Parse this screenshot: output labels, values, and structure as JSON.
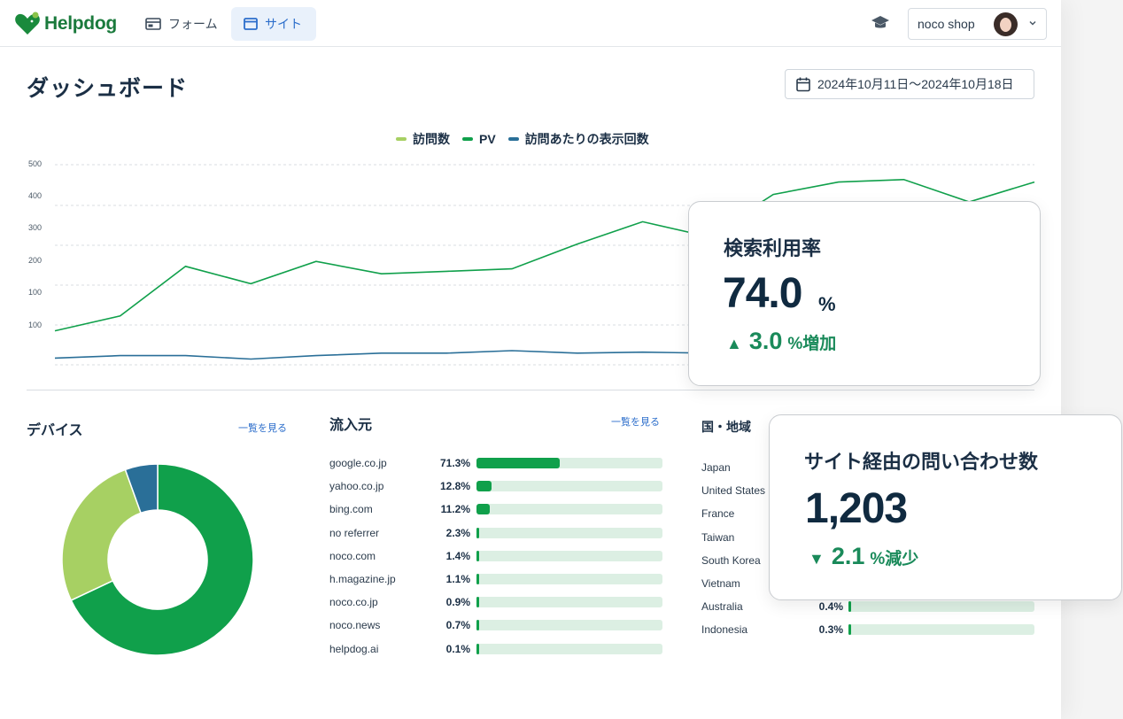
{
  "topbar": {
    "logo_text": "Helpdog",
    "nav": [
      {
        "label": "フォーム",
        "icon": "form-icon"
      },
      {
        "label": "サイト",
        "icon": "window-icon",
        "active": true
      }
    ],
    "shop_name": "noco shop"
  },
  "header": {
    "title": "ダッシュボード",
    "date_range": "2024年10月11日〜2024年10月18日"
  },
  "chart_data": {
    "type": "line",
    "legend": [
      {
        "name": "訪問数",
        "color": "#a7d063"
      },
      {
        "name": "PV",
        "color": "#10a04b"
      },
      {
        "name": "訪問あたりの表示回数",
        "color": "#2a6f98"
      }
    ],
    "y_tick_labels": [
      "500",
      "400",
      "300",
      "200",
      "100",
      "100"
    ],
    "series": [
      {
        "name": "PV",
        "color": "#10a04b",
        "values": [
          145,
          175,
          275,
          240,
          285,
          260,
          265,
          270,
          320,
          365,
          335,
          420,
          445,
          450,
          405,
          445
        ]
      },
      {
        "name": "訪問あたりの表示回数",
        "color": "#2a6f98",
        "values": [
          90,
          95,
          95,
          88,
          95,
          100,
          100,
          105,
          100,
          102,
          100,
          100,
          100,
          100,
          100,
          100
        ]
      }
    ],
    "ylim": [
      80,
      480
    ]
  },
  "devices": {
    "title": "デバイス",
    "link": "一覧を見る",
    "chart_data": {
      "type": "pie",
      "slices": [
        {
          "value": 68,
          "color": "#10a04b"
        },
        {
          "value": 26.5,
          "color": "#a7d063"
        },
        {
          "value": 5.5,
          "color": "#2a6f98"
        }
      ]
    }
  },
  "sources": {
    "title": "流入元",
    "link": "一覧を見る",
    "rows": [
      {
        "label": "google.co.jp",
        "pct": "71.3%",
        "value": 71.3
      },
      {
        "label": "yahoo.co.jp",
        "pct": "12.8%",
        "value": 12.8
      },
      {
        "label": "bing.com",
        "pct": "11.2%",
        "value": 11.2
      },
      {
        "label": "no referrer",
        "pct": "2.3%",
        "value": 2.3
      },
      {
        "label": "noco.com",
        "pct": "1.4%",
        "value": 1.4
      },
      {
        "label": "h.magazine.jp",
        "pct": "1.1%",
        "value": 1.1
      },
      {
        "label": "noco.co.jp",
        "pct": "0.9%",
        "value": 0.9
      },
      {
        "label": "noco.news",
        "pct": "0.7%",
        "value": 0.7
      },
      {
        "label": "helpdog.ai",
        "pct": "0.1%",
        "value": 0.1
      }
    ]
  },
  "regions": {
    "title": "国・地域",
    "rows": [
      {
        "label": "Japan"
      },
      {
        "label": "United States"
      },
      {
        "label": "France"
      },
      {
        "label": "Taiwan"
      },
      {
        "label": "South Korea"
      },
      {
        "label": "Vietnam"
      },
      {
        "label": "Australia",
        "pct": "0.4%",
        "value": 0.4
      },
      {
        "label": "Indonesia",
        "pct": "0.3%",
        "value": 0.3
      }
    ]
  },
  "card_search": {
    "title": "検索利用率",
    "value": "74.0",
    "unit": "%",
    "arrow": "▲",
    "delta": "3.0",
    "delta_text": "%増加"
  },
  "card_inquiries": {
    "title": "サイト経由の問い合わせ数",
    "value": "1,203",
    "arrow": "▼",
    "delta": "2.1",
    "delta_text": "%減少"
  }
}
